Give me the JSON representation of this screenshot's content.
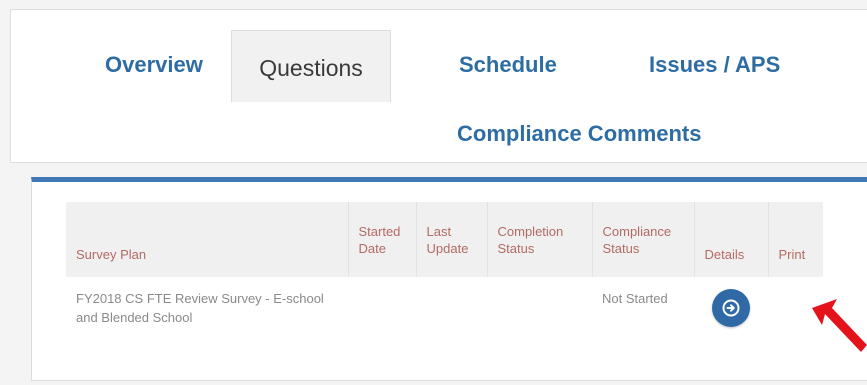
{
  "tabs": {
    "overview": "Overview",
    "questions": "Questions",
    "schedule": "Schedule",
    "issues": "Issues / APS",
    "compliance": "Compliance Comments",
    "active": "Questions"
  },
  "table": {
    "columns": {
      "survey_plan": "Survey Plan",
      "started_date": "Started Date",
      "last_update": "Last Update",
      "completion_status": "Completion Status",
      "compliance_status": "Compliance Status",
      "details": "Details",
      "print": "Print"
    },
    "rows": [
      {
        "survey_plan": "FY2018 CS FTE Review Survey - E-school and Blended School",
        "started_date": "",
        "last_update": "",
        "completion_status": "",
        "compliance_status": "Not Started",
        "details_icon": "circle-arrow-right-icon",
        "print": ""
      }
    ]
  },
  "annotation": {
    "icon": "red-arrow-icon",
    "color": "#e3121b"
  },
  "colors": {
    "tab_link": "#2e6da4",
    "card_accent": "#3f78b5",
    "header_text": "#b56a62",
    "button": "#2f6aa6"
  }
}
